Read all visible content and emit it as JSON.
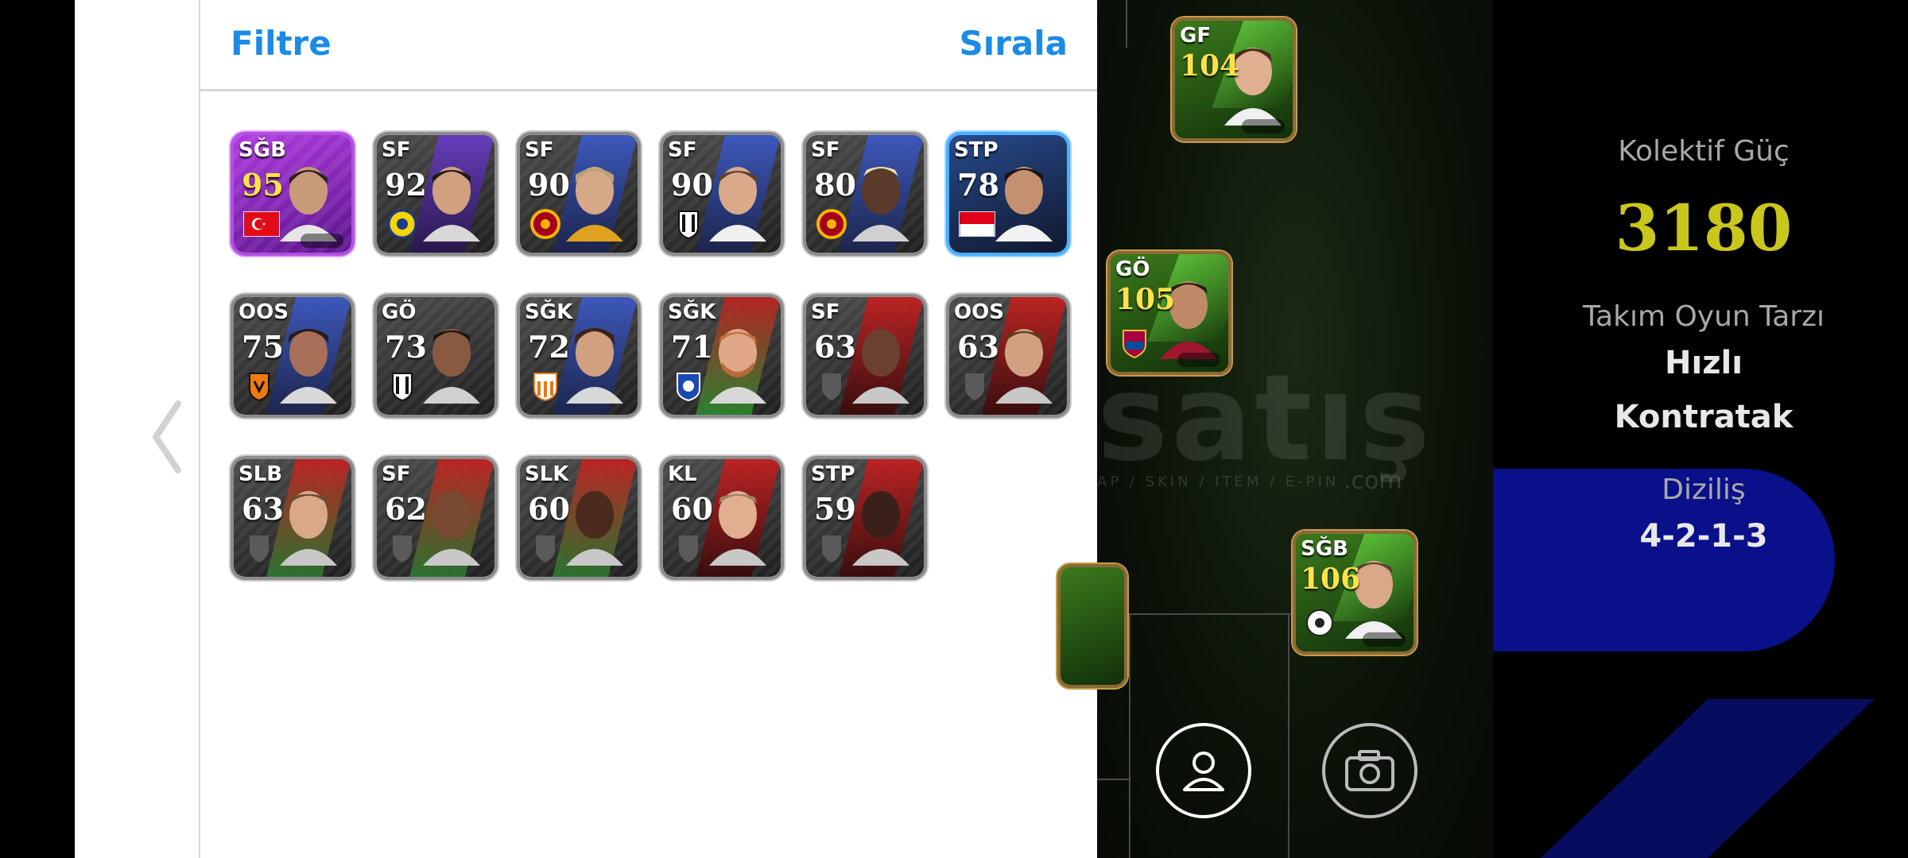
{
  "panel": {
    "filter_label": "Filtre",
    "sort_label": "Sırala"
  },
  "player_cards": [
    {
      "position": "SĞB",
      "rating": "95",
      "style": "special",
      "badge": "flag-turkey"
    },
    {
      "position": "SF",
      "rating": "92",
      "style": "normal",
      "badge": "al-nassr-badge"
    },
    {
      "position": "SF",
      "rating": "90",
      "style": "normal",
      "badge": "galatasaray-badge"
    },
    {
      "position": "SF",
      "rating": "90",
      "style": "normal",
      "badge": "besiktas-badge"
    },
    {
      "position": "SF",
      "rating": "80",
      "style": "normal",
      "badge": "galatasaray-badge"
    },
    {
      "position": "STP",
      "rating": "78",
      "style": "blue",
      "badge": "flag-indonesia"
    },
    {
      "position": "OOS",
      "rating": "75",
      "style": "normal",
      "badge": "club-badge"
    },
    {
      "position": "GÖ",
      "rating": "73",
      "style": "normal",
      "badge": "besiktas-badge"
    },
    {
      "position": "SĞK",
      "rating": "72",
      "style": "normal",
      "badge": "club-badge"
    },
    {
      "position": "SĞK",
      "rating": "71",
      "style": "normal",
      "badge": "club-badge"
    },
    {
      "position": "SF",
      "rating": "63",
      "style": "normal",
      "badge": "shield-placeholder"
    },
    {
      "position": "OOS",
      "rating": "63",
      "style": "normal",
      "badge": "shield-placeholder"
    },
    {
      "position": "SLB",
      "rating": "63",
      "style": "normal",
      "badge": "shield-placeholder"
    },
    {
      "position": "SF",
      "rating": "62",
      "style": "normal",
      "badge": "shield-placeholder"
    },
    {
      "position": "SLK",
      "rating": "60",
      "style": "normal",
      "badge": "shield-placeholder"
    },
    {
      "position": "KL",
      "rating": "60",
      "style": "normal",
      "badge": "shield-placeholder"
    },
    {
      "position": "STP",
      "rating": "59",
      "style": "normal",
      "badge": "shield-placeholder"
    }
  ],
  "formation_cards": [
    {
      "position": "GF",
      "rating": "104"
    },
    {
      "position": "GÖ",
      "rating": "105"
    },
    {
      "position": "SĞB",
      "rating": "106"
    }
  ],
  "watermark": {
    "brand": "satış",
    "sub": "AP / SKIN / ITEM / E-PIN",
    "domain": ".com"
  },
  "team": {
    "power_label": "Kolektif Güç",
    "power_value": "3180",
    "style_label": "Takım Oyun Tarzı",
    "style_value_1": "Hızlı",
    "style_value_2": "Kontratak",
    "formation_label": "Diziliş",
    "formation_value": "4-2-1-3"
  },
  "colors": {
    "accent": "#1c8be6",
    "power": "#c9c61c",
    "formation_bg": "#09108a"
  }
}
